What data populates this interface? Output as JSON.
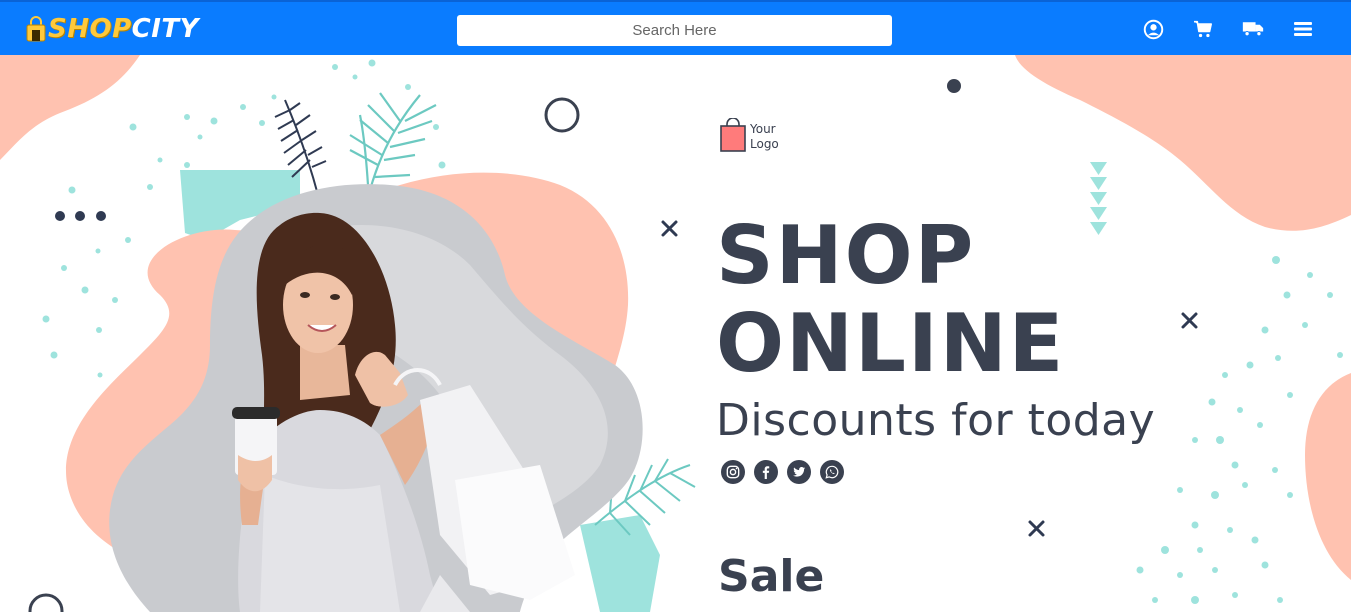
{
  "header": {
    "brand_part1": "SHOP",
    "brand_part2": "CITY",
    "search_placeholder": "Search Here",
    "icons": [
      "user-circle-icon",
      "cart-icon",
      "truck-icon",
      "menu-icon"
    ]
  },
  "hero": {
    "logo_line1": "Your",
    "logo_line2": "Logo",
    "title_line1": "SHOP",
    "title_line2": "ONLINE",
    "subtitle": "Discounts for today",
    "social_icons": [
      "instagram-icon",
      "facebook-icon",
      "twitter-icon",
      "whatsapp-icon"
    ],
    "sale_label": "Sale"
  },
  "colors": {
    "navbar": "#0a7cff",
    "brand_yellow": "#ffc93b",
    "peach": "#ffc2b0",
    "mint": "#9ee3dd",
    "navy_text": "#3a4150",
    "photo_bg": "#c9cbcf"
  }
}
